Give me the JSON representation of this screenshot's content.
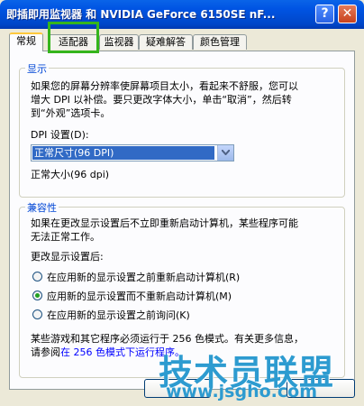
{
  "window": {
    "title": "即插即用监视器 和 NVIDIA GeForce 6150SE nF...",
    "help_label": "?",
    "close_label": "✕"
  },
  "tabs": [
    {
      "label": "常规",
      "active": true
    },
    {
      "label": "适配器",
      "active": false
    },
    {
      "label": "监视器",
      "active": false
    },
    {
      "label": "疑难解答",
      "active": false
    },
    {
      "label": "颜色管理",
      "active": false
    }
  ],
  "display": {
    "legend": "显示",
    "desc_line1": "如果您的屏幕分辨率使屏幕项目太小，看起来不舒服，您可以",
    "desc_line2": "增大 DPI 以补偿。要只更改字体大小，单击“取消”，然后转",
    "desc_line3": "到“外观”选项卡。",
    "dpi_label": "DPI 设置(D):",
    "dpi_value": "正常尺寸(96 DPI)",
    "dpi_caption": "正常大小(96 dpi)"
  },
  "compat": {
    "legend": "兼容性",
    "desc_line1": "如果在更改显示设置后不立即重新启动计算机，某些程序可能",
    "desc_line2": "无法正常工作。",
    "after_label": "更改显示设置后:",
    "options": [
      {
        "label": "在应用新的显示设置之前重新启动计算机(R)",
        "checked": false
      },
      {
        "label": "应用新的显示设置而不重新启动计算机(M)",
        "checked": true
      },
      {
        "label": "在应用新的显示设置之前询问(K)",
        "checked": false
      }
    ],
    "note_line1": "某些游戏和其它程序必须运行于 256 色模式。有关更多信息，",
    "note_prefix": "请参阅",
    "note_link": "在 256 色模式下运行程序。"
  },
  "watermark": {
    "logo": "技术员联盟",
    "url": "www.jsgho.com"
  }
}
